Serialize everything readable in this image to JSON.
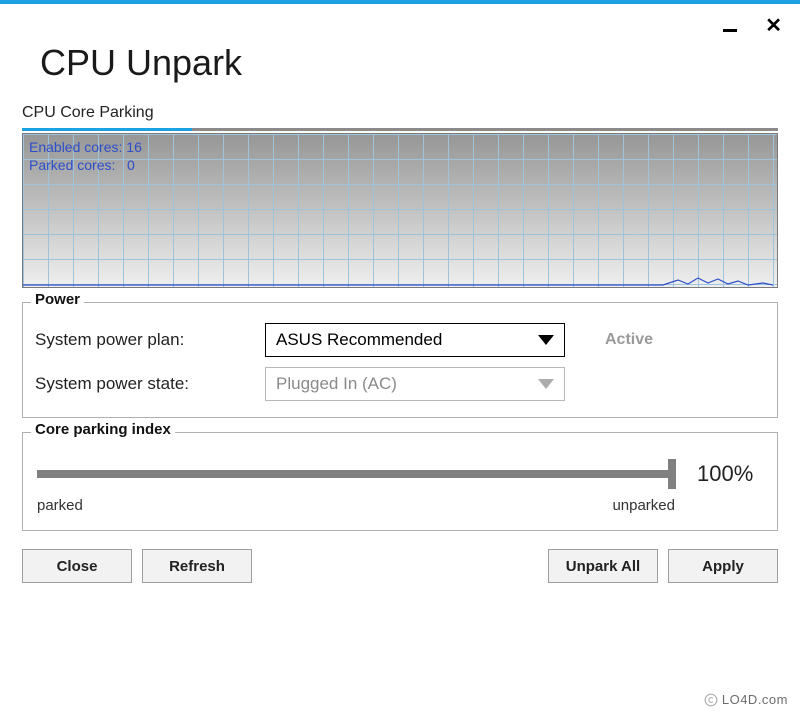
{
  "app": {
    "title": "CPU Unpark"
  },
  "titlebar": {
    "minimize_tooltip": "Minimize",
    "close_tooltip": "Close"
  },
  "parking": {
    "section_label": "CPU Core Parking",
    "enabled_label": "Enabled cores:",
    "enabled_value": "16",
    "parked_label": "Parked cores:",
    "parked_value": "0"
  },
  "power": {
    "group_title": "Power",
    "plan_label": "System power plan:",
    "plan_value": "ASUS Recommended",
    "state_label": "System power state:",
    "state_value": "Plugged In (AC)",
    "active_badge": "Active"
  },
  "slider": {
    "group_title": "Core parking index",
    "value_text": "100%",
    "left_label": "parked",
    "right_label": "unparked"
  },
  "buttons": {
    "close": "Close",
    "refresh": "Refresh",
    "unpark_all": "Unpark All",
    "apply": "Apply"
  },
  "watermark": {
    "text": "LO4D.com"
  },
  "chart_data": {
    "type": "line",
    "title": "CPU Core Parking",
    "xlabel": "",
    "ylabel": "",
    "ylim": [
      0,
      100
    ],
    "series": [
      {
        "name": "Enabled cores",
        "value": 16
      },
      {
        "name": "Parked cores",
        "value": 0
      }
    ],
    "activity_samples": [
      0,
      0,
      0,
      0,
      0,
      0,
      0,
      0,
      0,
      0,
      0,
      0,
      0,
      0,
      0,
      0,
      0,
      0,
      0,
      0,
      0,
      0,
      0,
      0,
      0,
      0,
      5,
      2,
      6,
      3,
      4,
      1
    ]
  },
  "colors": {
    "accent": "#1BA1E2",
    "chart_line": "#2d4ec9",
    "grid": "#9ec3dc"
  }
}
